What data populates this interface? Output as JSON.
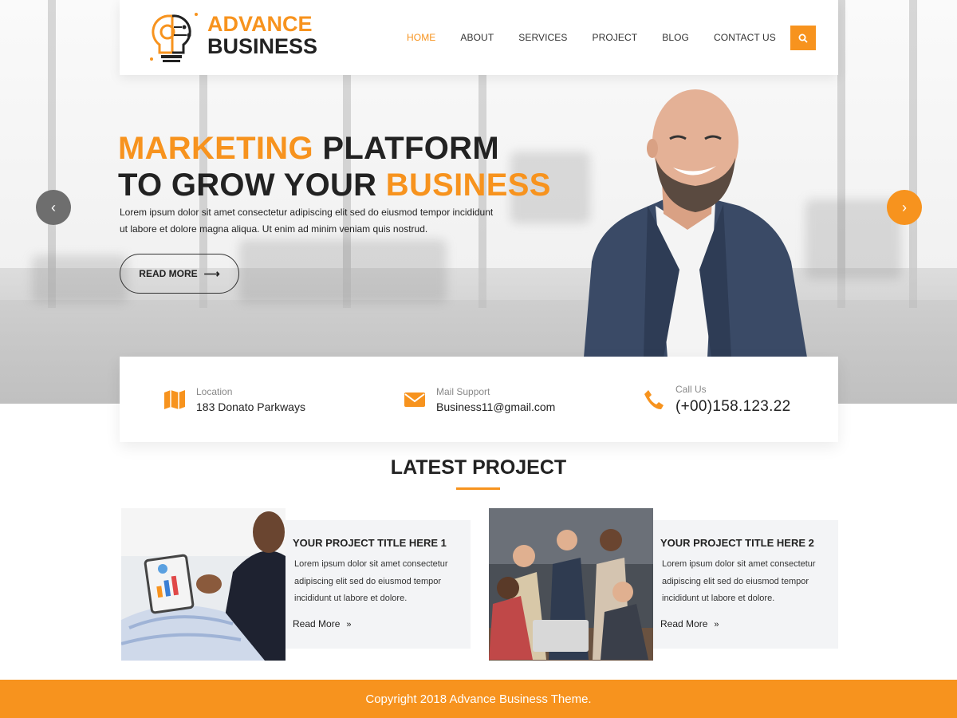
{
  "brand": {
    "line1": "ADVANCE",
    "line2": "BUSINESS",
    "icon": "lightbulb-gear-icon",
    "accent_color": "#f7931e"
  },
  "nav": {
    "items": [
      {
        "label": "HOME",
        "active": true
      },
      {
        "label": "ABOUT",
        "active": false
      },
      {
        "label": "SERVICES",
        "active": false
      },
      {
        "label": "PROJECT",
        "active": false
      },
      {
        "label": "BLOG",
        "active": false
      },
      {
        "label": "CONTACT US",
        "active": false
      }
    ],
    "search_icon": "search-icon"
  },
  "hero": {
    "headline_part1": "MARKETING",
    "headline_part2": " PLATFORM",
    "headline_part3": "TO GROW YOUR ",
    "headline_part4": "BUSINESS",
    "description_line1": "Lorem ipsum dolor sit amet consectetur adipiscing elit sed do eiusmod tempor incididunt",
    "description_line2": "ut labore et dolore magna aliqua. Ut enim ad minim veniam quis nostrud.",
    "button_label": "READ MORE",
    "prev_icon": "chevron-left-icon",
    "next_icon": "chevron-right-icon"
  },
  "contact": {
    "location": {
      "label": "Location",
      "value": "183 Donato Parkways",
      "icon": "map-icon"
    },
    "mail": {
      "label": "Mail Support",
      "value": "Business11@gmail.com",
      "icon": "envelope-icon"
    },
    "call": {
      "label": "Call Us",
      "value": "(+00)158.123.22",
      "icon": "phone-icon"
    }
  },
  "latest_project": {
    "title": "LATEST PROJECT",
    "projects": [
      {
        "title": "YOUR PROJECT TITLE HERE 1",
        "desc_line1": "Lorem ipsum dolor sit amet consectetur",
        "desc_line2": "adipiscing elit sed do eiusmod tempor",
        "desc_line3": "incididunt ut labore et dolore.",
        "more": "Read More"
      },
      {
        "title": "YOUR PROJECT TITLE HERE 2",
        "desc_line1": "Lorem ipsum dolor sit amet consectetur",
        "desc_line2": "adipiscing elit sed do eiusmod tempor",
        "desc_line3": "incididunt ut labore et dolore.",
        "more": "Read More"
      }
    ]
  },
  "footer": {
    "copyright": "Copyright 2018 Advance Business Theme."
  }
}
